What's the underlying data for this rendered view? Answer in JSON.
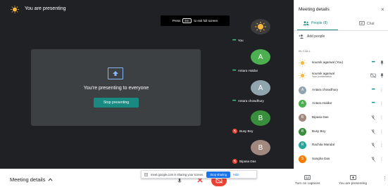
{
  "header": {
    "presenting_label": "You are presenting"
  },
  "fullscreen_hint": {
    "press": "Press",
    "key": "Esc",
    "suffix": "to exit full screen"
  },
  "presentation": {
    "message": "You're presenting to everyone",
    "stop_label": "Stop presenting"
  },
  "tiles": [
    {
      "name": "You",
      "letter": "",
      "color": "#f6b93b",
      "status": "speaking"
    },
    {
      "name": "Antara Haldar",
      "letter": "A",
      "color": "#4caf50",
      "status": "speaking"
    },
    {
      "name": "Antara chowdhury",
      "letter": "A",
      "color": "#90a4ae",
      "status": "speaking"
    },
    {
      "name": "Busy Boy",
      "letter": "B",
      "color": "#388e3c",
      "status": "muted"
    },
    {
      "name": "Bipasa Das",
      "letter": "B",
      "color": "#a1887f",
      "status": "muted"
    }
  ],
  "panel": {
    "title": "Meeting details",
    "tab_people": "People (8)",
    "tab_chat": "Chat",
    "add_people": "Add people",
    "in_call_label": "IN CALL",
    "participants": [
      {
        "name": "soumik agarwal (You)",
        "sub": "",
        "letter": "",
        "color": "#f6b93b",
        "status": "speaking"
      },
      {
        "name": "soumik agarwal",
        "sub": "Your presentation",
        "letter": "",
        "color": "#f6b93b",
        "status": "presentation"
      },
      {
        "name": "Antara chowdhury",
        "sub": "",
        "letter": "A",
        "color": "#90a4ae",
        "status": "speaking"
      },
      {
        "name": "Antara Haldar",
        "sub": "",
        "letter": "A",
        "color": "#4caf50",
        "status": "speaking"
      },
      {
        "name": "Bipasa Das",
        "sub": "",
        "letter": "B",
        "color": "#a1887f",
        "status": "muted"
      },
      {
        "name": "Busy Boy",
        "sub": "",
        "letter": "B",
        "color": "#388e3c",
        "status": "muted"
      },
      {
        "name": "Rachita Mandal",
        "sub": "",
        "letter": "R",
        "color": "#26a69a",
        "status": "muted"
      },
      {
        "name": "Sangha Das",
        "sub": "",
        "letter": "S",
        "color": "#f57c00",
        "status": "muted"
      }
    ]
  },
  "bottom": {
    "meeting_details": "Meeting details",
    "share_text": "meet.google.com is sharing your screen.",
    "stop_sharing": "Stop sharing",
    "hide": "Hide",
    "captions": "Turn on captions",
    "presenting": "You are presenting"
  },
  "colors": {
    "accent": "#1a8a80",
    "stage": "#202124",
    "danger": "#ea4335"
  }
}
